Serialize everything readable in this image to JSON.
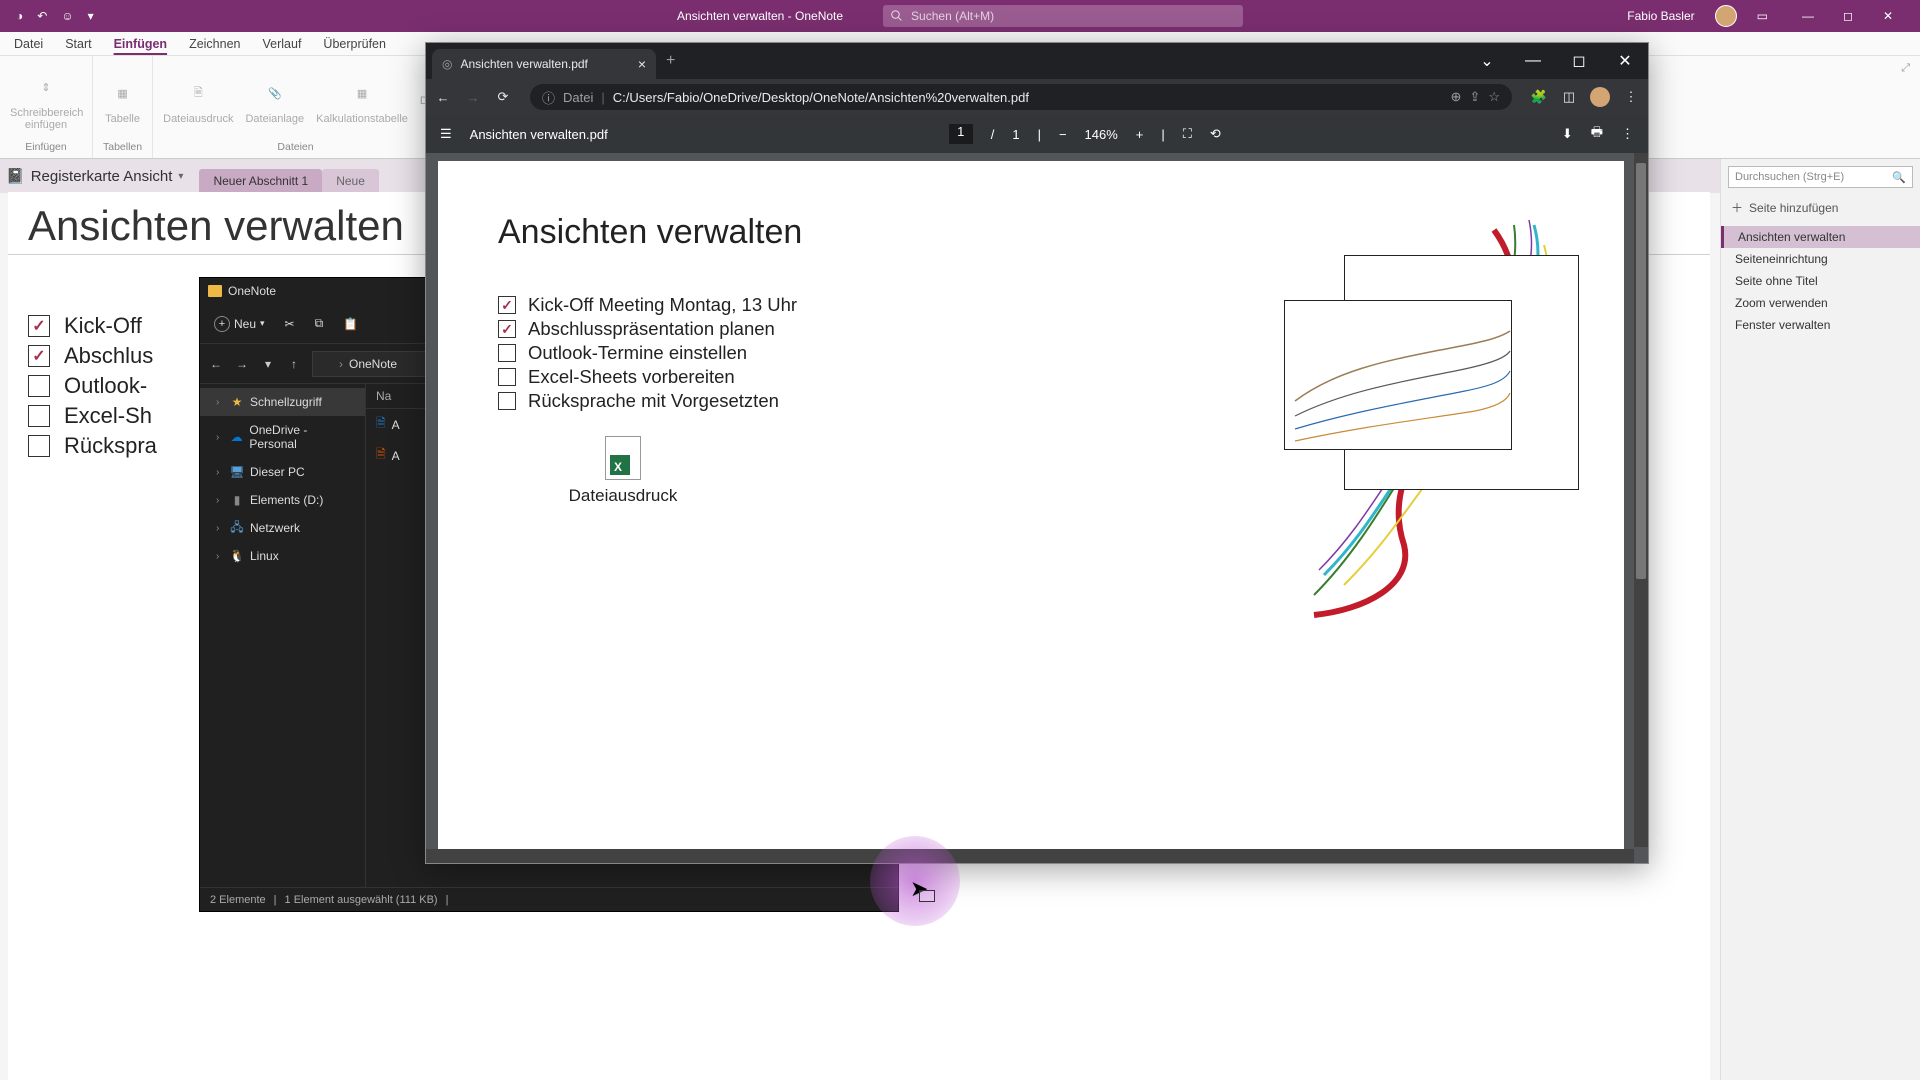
{
  "titlebar": {
    "title": "Ansichten verwalten  -  OneNote",
    "search_placeholder": "Suchen (Alt+M)",
    "user": "Fabio Basler"
  },
  "ribbon_tabs": [
    "Datei",
    "Start",
    "Einfügen",
    "Zeichnen",
    "Verlauf",
    "Überprüfen"
  ],
  "ribbon": {
    "groups": [
      {
        "label": "Einfügen",
        "cmds": [
          "Schreibbereich einfügen"
        ]
      },
      {
        "label": "Tabellen",
        "cmds": [
          "Tabelle"
        ]
      },
      {
        "label": "Dateien",
        "cmds": [
          "Dateiausdruck",
          "Dateianlage",
          "Kalkulationstabelle",
          "D"
        ]
      }
    ]
  },
  "section": {
    "title": "Registerkarte Ansicht",
    "tabs": [
      "Neuer Abschnitt 1",
      "Neue"
    ]
  },
  "page": {
    "title": "Ansichten verwalten",
    "checklist": [
      {
        "text": "Kick-Off",
        "checked": true
      },
      {
        "text": "Abschlus",
        "checked": true
      },
      {
        "text": "Outlook-",
        "checked": false
      },
      {
        "text": "Excel-Sh",
        "checked": false
      },
      {
        "text": "Rückspra",
        "checked": false
      }
    ]
  },
  "sidepanel": {
    "search_placeholder": "Durchsuchen (Strg+E)",
    "add_label": "Seite hinzufügen",
    "items": [
      "Ansichten verwalten",
      "Seiteneinrichtung",
      "Seite ohne Titel",
      "Zoom verwenden",
      "Fenster verwalten"
    ]
  },
  "explorer": {
    "title": "OneNote",
    "new": "Neu",
    "breadcrumb": "OneNote",
    "columns": {
      "name": "Na"
    },
    "sidenav": [
      {
        "label": "Schnellzugriff",
        "ico": "⭐",
        "sel": true
      },
      {
        "label": "OneDrive - Personal",
        "ico": "云"
      },
      {
        "label": "Dieser PC",
        "ico": "🖵"
      },
      {
        "label": "Elements (D:)",
        "ico": "💾"
      },
      {
        "label": "Netzwerk",
        "ico": "🖧"
      },
      {
        "label": "Linux",
        "ico": "🐧"
      }
    ],
    "files": [
      {
        "name": "A",
        "ico": "🟦"
      },
      {
        "name": "A",
        "ico": "🟧"
      }
    ],
    "status": {
      "count": "2 Elemente",
      "selected": "1 Element ausgewählt (111 KB)"
    }
  },
  "browser": {
    "tab": "Ansichten verwalten.pdf",
    "url_scheme": "Datei",
    "url_path": "C:/Users/Fabio/OneDrive/Desktop/OneNote/Ansichten%20verwalten.pdf",
    "pdf": {
      "filename": "Ansichten verwalten.pdf",
      "page_cur": "1",
      "page_total": "1",
      "zoom": "146%",
      "title": "Ansichten verwalten",
      "checklist": [
        {
          "text": "Kick-Off Meeting Montag, 13 Uhr",
          "checked": true
        },
        {
          "text": "Abschlusspräsentation planen",
          "checked": true
        },
        {
          "text": "Outlook-Termine einstellen",
          "checked": false
        },
        {
          "text": "Excel-Sheets vorbereiten",
          "checked": false
        },
        {
          "text": "Rücksprache mit Vorgesetzten",
          "checked": false
        }
      ],
      "attachment_label": "Dateiausdruck"
    }
  }
}
